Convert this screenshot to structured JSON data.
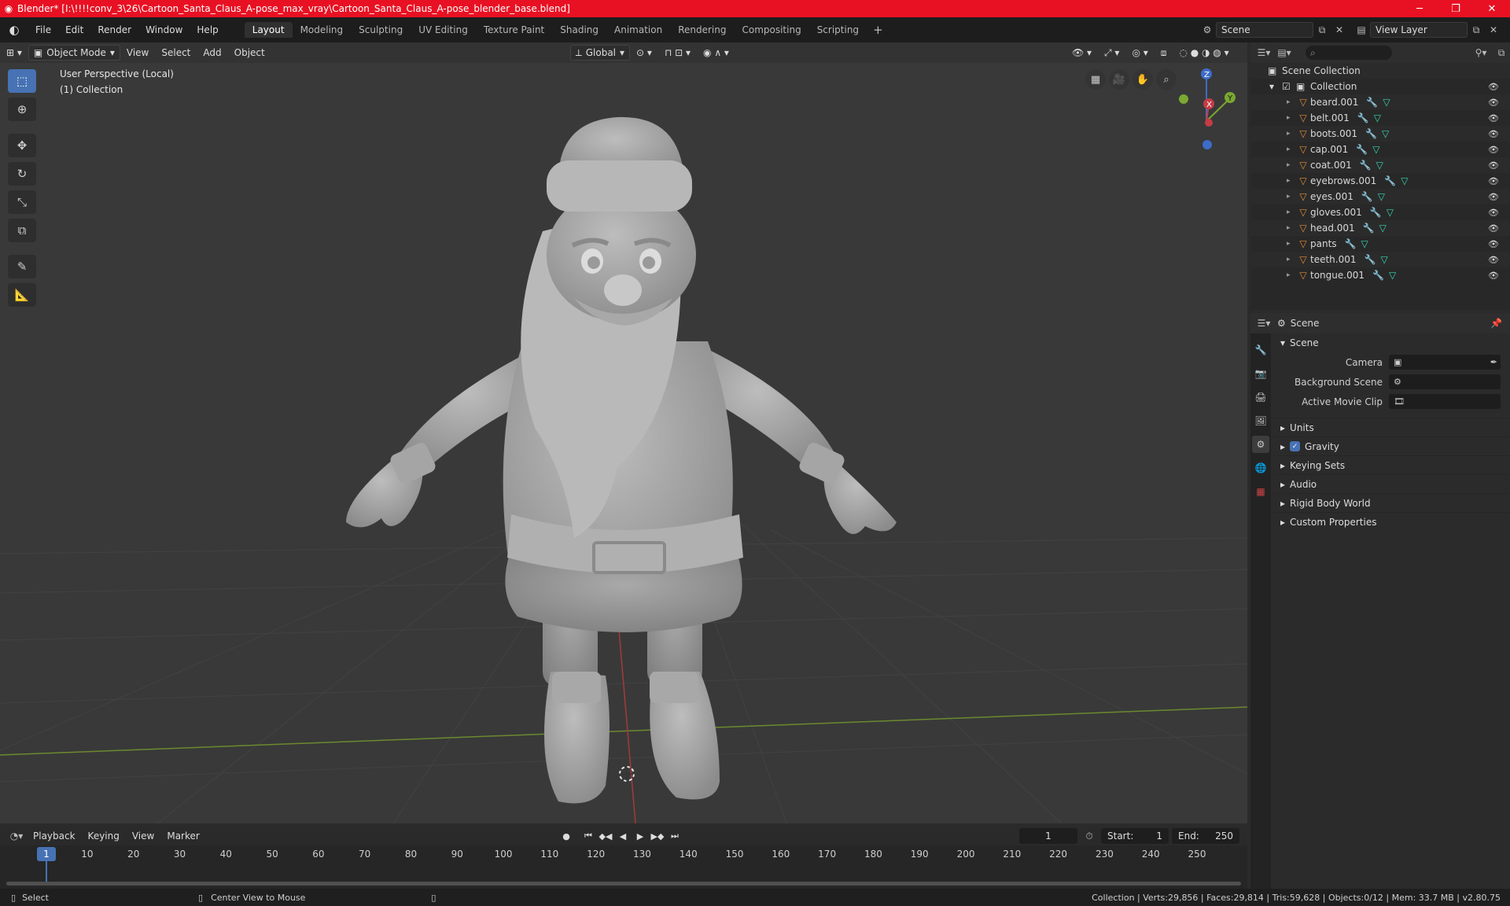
{
  "window": {
    "title": "Blender* [I:\\!!!!conv_3\\26\\Cartoon_Santa_Claus_A-pose_max_vray\\Cartoon_Santa_Claus_A-pose_blender_base.blend]"
  },
  "menu": [
    "File",
    "Edit",
    "Render",
    "Window",
    "Help"
  ],
  "workspaces": [
    {
      "label": "Layout",
      "active": true
    },
    {
      "label": "Modeling"
    },
    {
      "label": "Sculpting"
    },
    {
      "label": "UV Editing"
    },
    {
      "label": "Texture Paint"
    },
    {
      "label": "Shading"
    },
    {
      "label": "Animation"
    },
    {
      "label": "Rendering"
    },
    {
      "label": "Compositing"
    },
    {
      "label": "Scripting"
    }
  ],
  "scene_selector": {
    "scene": "Scene",
    "view_layer": "View Layer"
  },
  "viewport": {
    "mode": "Object Mode",
    "menus": [
      "View",
      "Select",
      "Add",
      "Object"
    ],
    "orientation": "Global",
    "info_line1": "User Perspective (Local)",
    "info_line2": "(1) Collection",
    "gizmo": {
      "z": "Z",
      "y": "Y",
      "x": "X"
    }
  },
  "outliner": {
    "root": "Scene Collection",
    "collection": "Collection",
    "objects": [
      "beard.001",
      "belt.001",
      "boots.001",
      "cap.001",
      "coat.001",
      "eyebrows.001",
      "eyes.001",
      "gloves.001",
      "head.001",
      "pants",
      "teeth.001",
      "tongue.001"
    ]
  },
  "properties": {
    "context": "Scene",
    "panel": "Scene",
    "fields": [
      {
        "label": "Camera"
      },
      {
        "label": "Background Scene"
      },
      {
        "label": "Active Movie Clip"
      }
    ],
    "subpanels": [
      "Units",
      "Gravity",
      "Keying Sets",
      "Audio",
      "Rigid Body World",
      "Custom Properties"
    ]
  },
  "timeline": {
    "menus": [
      "Playback",
      "Keying",
      "View",
      "Marker"
    ],
    "current_frame": "1",
    "start_label": "Start:",
    "start": "1",
    "end_label": "End:",
    "end": "250",
    "ruler": [
      "1",
      "10",
      "20",
      "30",
      "40",
      "50",
      "60",
      "70",
      "80",
      "90",
      "100",
      "110",
      "120",
      "130",
      "140",
      "150",
      "160",
      "170",
      "180",
      "190",
      "200",
      "210",
      "220",
      "230",
      "240",
      "250"
    ]
  },
  "statusbar": {
    "left": "Select",
    "middle": "Center View to Mouse",
    "right": "Collection | Verts:29,856 | Faces:29,814 | Tris:59,628 | Objects:0/12 | Mem: 33.7 MB | v2.80.75"
  },
  "colors": {
    "accent": "#4772b3",
    "titlebar": "#e81123",
    "mesh": "#e28d35",
    "data": "#36d7b1"
  }
}
